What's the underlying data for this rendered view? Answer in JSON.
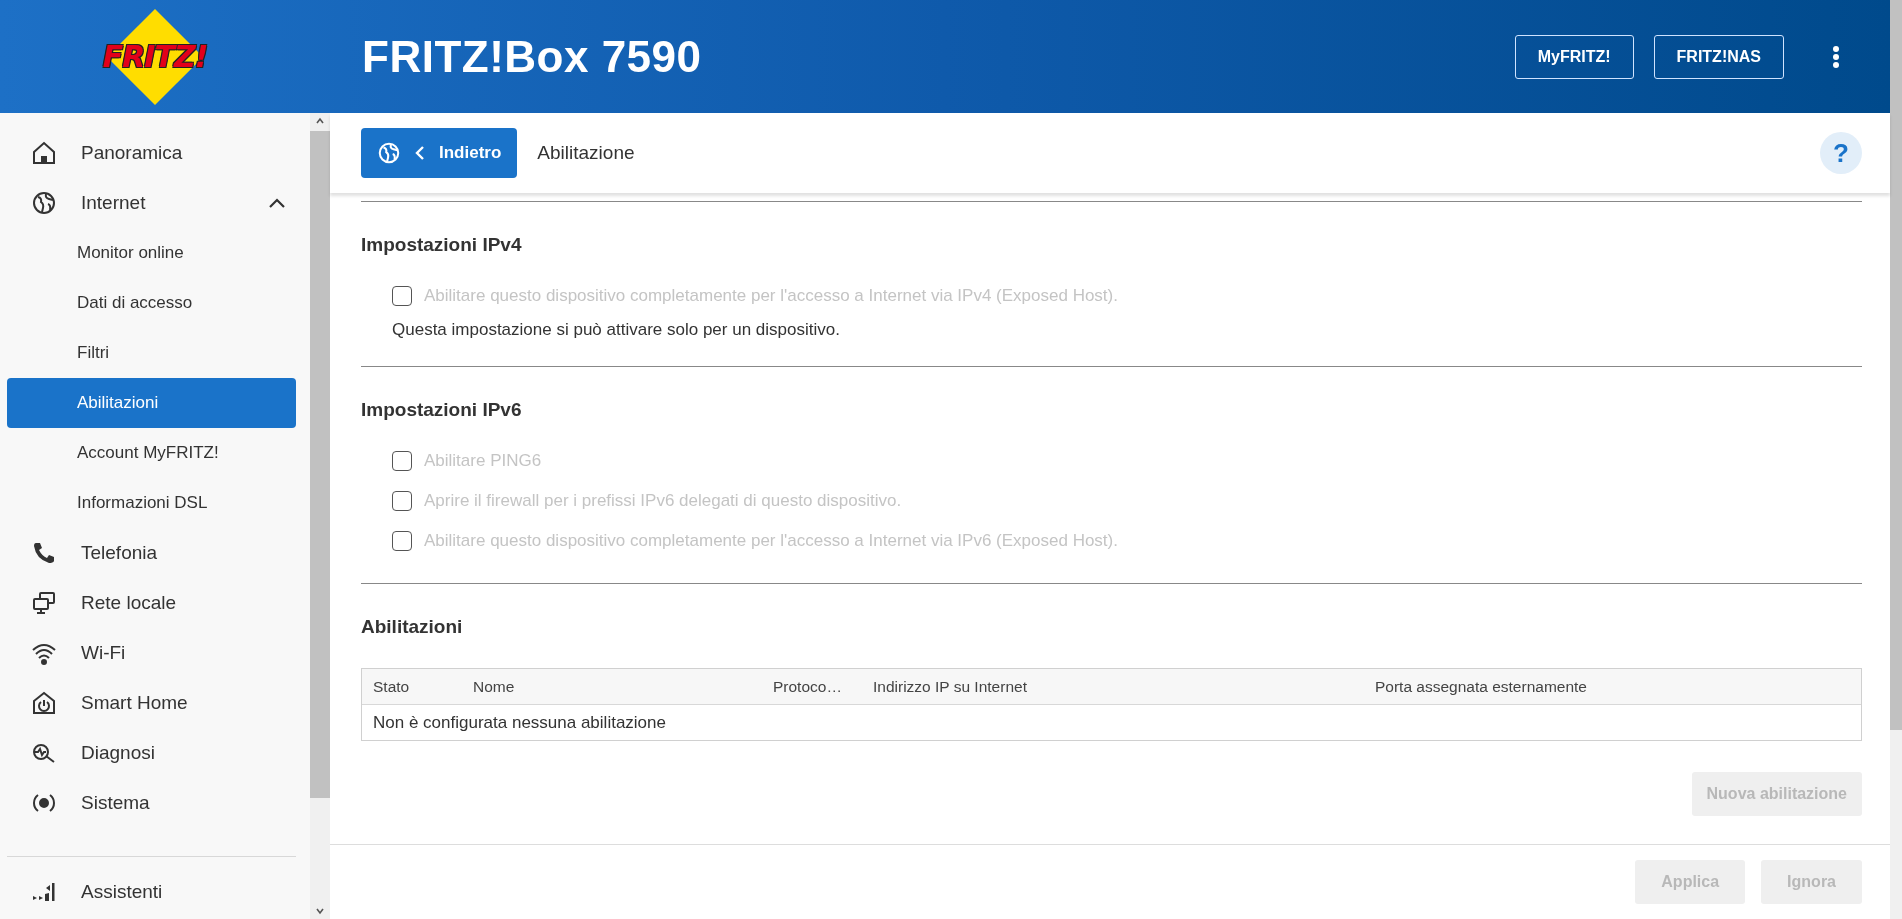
{
  "header": {
    "logo": "FRITZ!",
    "title": "FRITZ!Box 7590",
    "buttons": [
      "MyFRITZ!",
      "FRITZ!NAS"
    ]
  },
  "sidebar": {
    "items": [
      {
        "label": "Panoramica",
        "selected": false
      },
      {
        "label": "Internet",
        "selected": false,
        "expanded": true,
        "children": [
          {
            "label": "Monitor online",
            "selected": false
          },
          {
            "label": "Dati di accesso",
            "selected": false
          },
          {
            "label": "Filtri",
            "selected": false
          },
          {
            "label": "Abilitazioni",
            "selected": true
          },
          {
            "label": "Account MyFRITZ!",
            "selected": false
          },
          {
            "label": "Informazioni DSL",
            "selected": false
          }
        ]
      },
      {
        "label": "Telefonia",
        "selected": false
      },
      {
        "label": "Rete locale",
        "selected": false
      },
      {
        "label": "Wi-Fi",
        "selected": false
      },
      {
        "label": "Smart Home",
        "selected": false
      },
      {
        "label": "Diagnosi",
        "selected": false
      },
      {
        "label": "Sistema",
        "selected": false
      }
    ],
    "footer_item": {
      "label": "Assistenti",
      "selected": false
    }
  },
  "toolbar": {
    "back_button": "Indietro",
    "title": "Abilitazione",
    "help": "?"
  },
  "ipv4": {
    "heading": "Impostazioni IPv4",
    "options": [
      {
        "label": "Abilitare questo dispositivo completamente per l'accesso a Internet via IPv4 (Exposed Host).",
        "checked": false,
        "disabled": true
      }
    ],
    "note": "Questa impostazione si può attivare solo per un dispositivo."
  },
  "ipv6": {
    "heading": "Impostazioni IPv6",
    "options": [
      {
        "label": "Abilitare PING6",
        "checked": false,
        "disabled": true
      },
      {
        "label": "Aprire il firewall per i prefissi IPv6 delegati di questo dispositivo.",
        "checked": false,
        "disabled": true
      },
      {
        "label": "Abilitare questo dispositivo completamente per l'accesso a Internet via IPv6 (Exposed Host).",
        "checked": false,
        "disabled": true
      }
    ]
  },
  "shares": {
    "heading": "Abilitazioni",
    "table": {
      "columns": [
        "Stato",
        "Nome",
        "Protoco…",
        "Indirizzo IP su Internet",
        "Porta assegnata esternamente"
      ],
      "empty_message": "Non è configurata nessuna abilitazione"
    },
    "new_button": {
      "label": "Nuova abilitazione",
      "disabled": true
    }
  },
  "footer_buttons": [
    {
      "label": "Applica",
      "disabled": true
    },
    {
      "label": "Ignora",
      "disabled": true
    }
  ]
}
